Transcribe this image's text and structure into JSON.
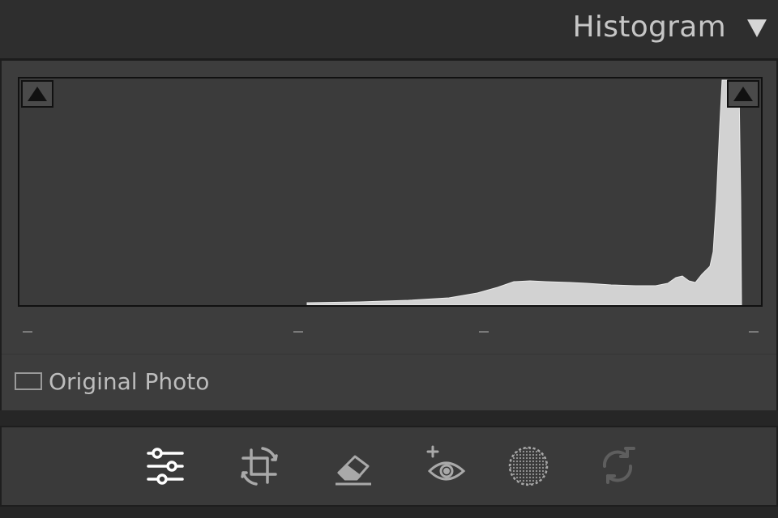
{
  "header": {
    "title": "Histogram",
    "toggle_icon": "triangle-down-icon"
  },
  "histogram": {
    "shadow_clip_icon": "triangle-up-icon",
    "highlight_clip_icon": "triangle-up-icon"
  },
  "original_photo": {
    "label": "Original Photo",
    "checked": false
  },
  "toolbar": {
    "tools": [
      {
        "icon": "edit-sliders-icon",
        "active": true
      },
      {
        "icon": "crop-rotate-icon",
        "active": false
      },
      {
        "icon": "eraser-icon",
        "active": false
      },
      {
        "icon": "red-eye-icon",
        "active": false
      },
      {
        "icon": "vignette-circle-icon",
        "active": false
      },
      {
        "icon": "sync-icon",
        "active": false,
        "disabled": true
      }
    ]
  },
  "colors": {
    "background": "#262626",
    "panel": "#3d3d3d",
    "histogram_fill": "#d0d0d0",
    "text": "#c6c6c6"
  }
}
